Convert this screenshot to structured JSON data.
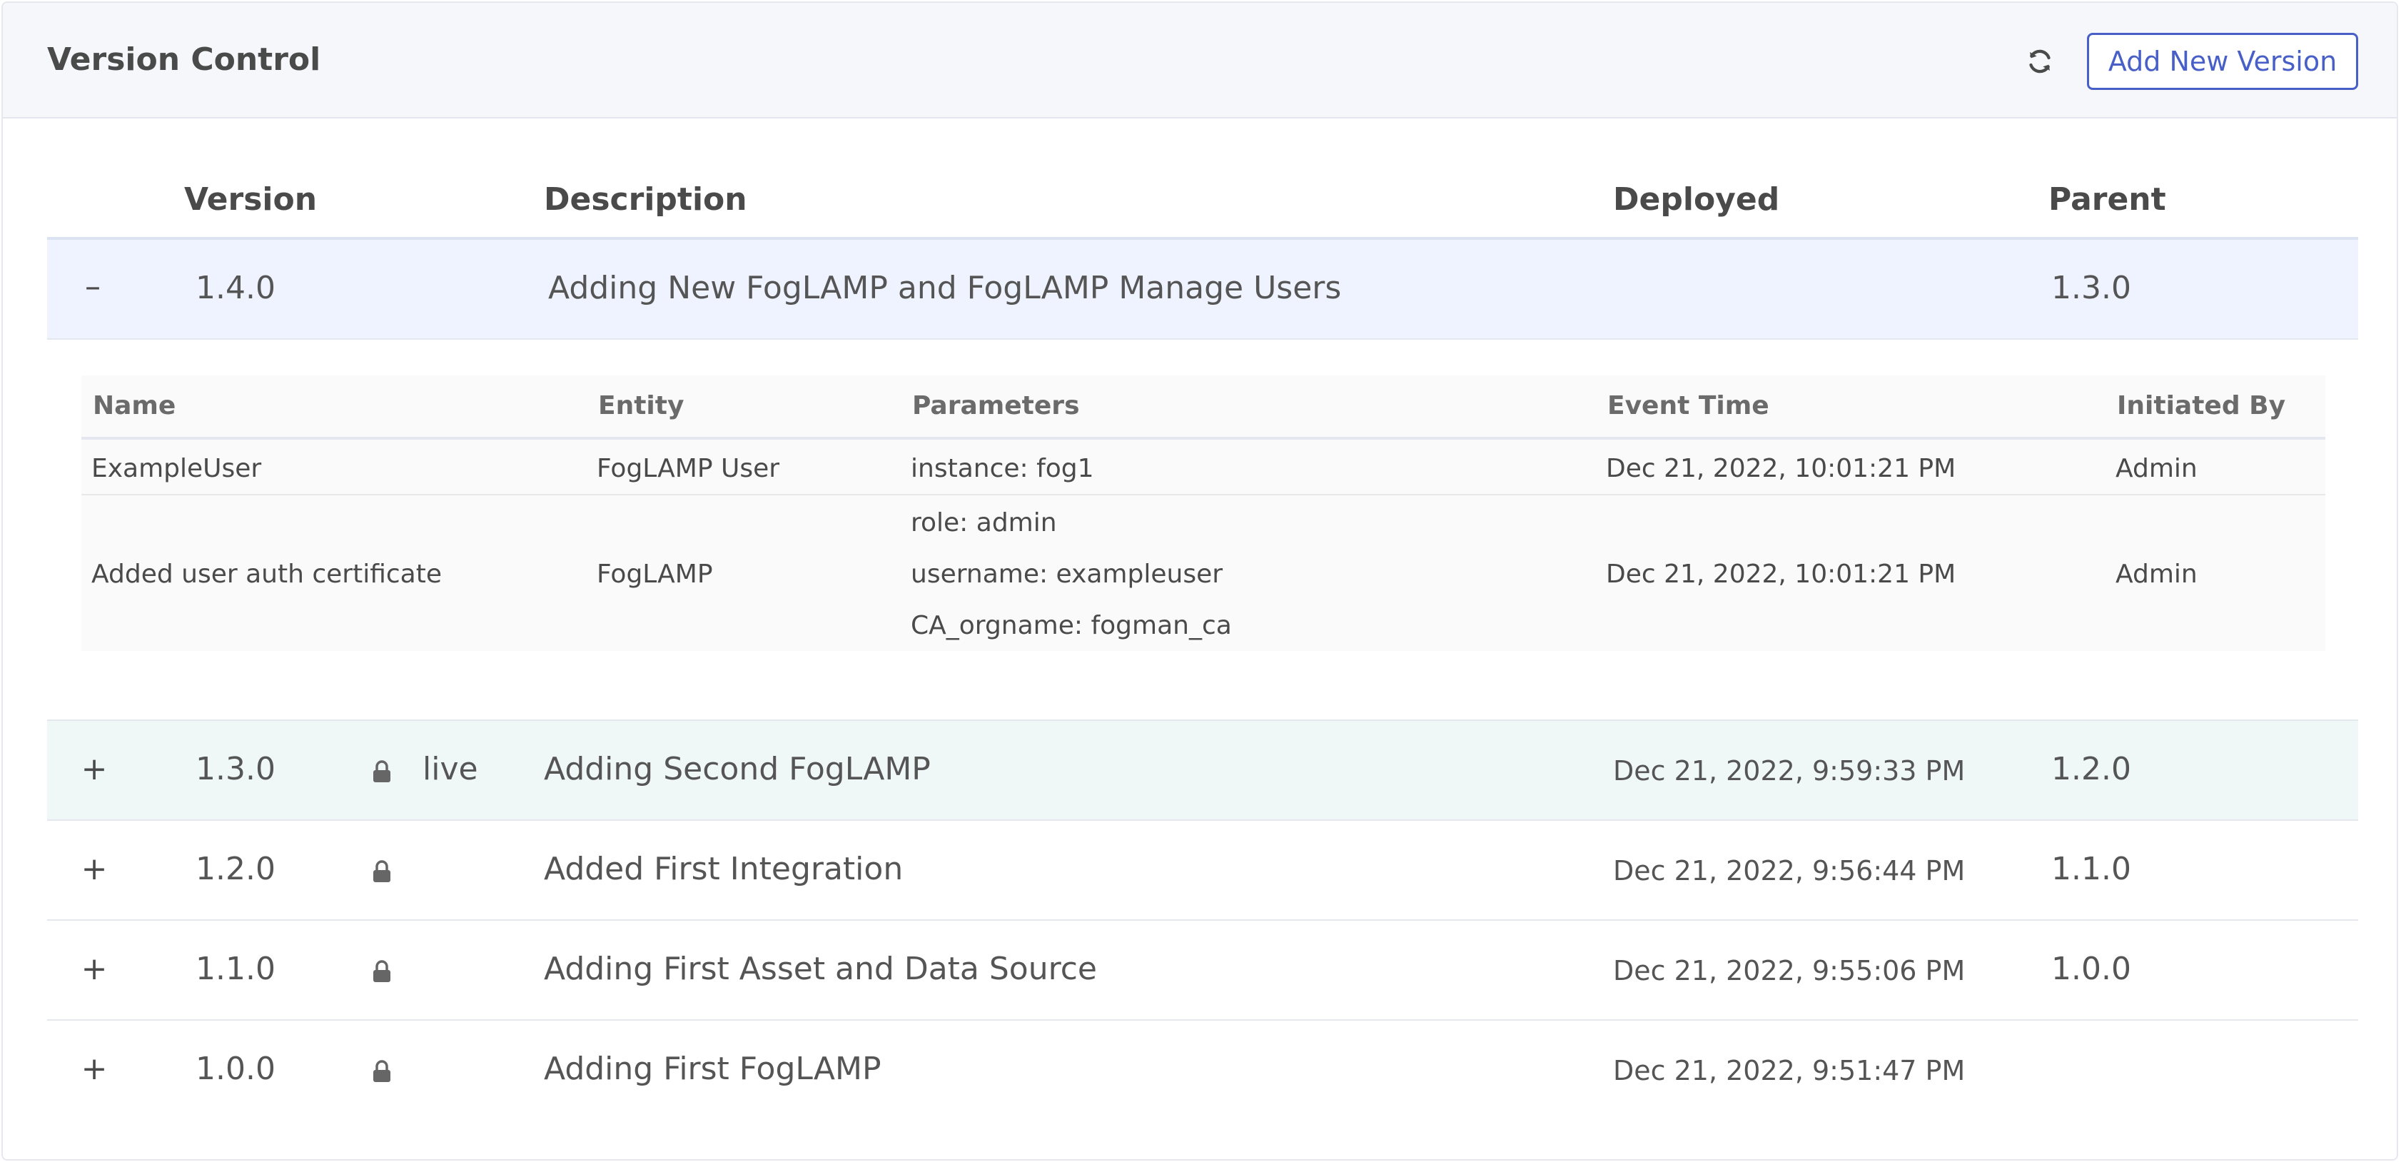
{
  "header": {
    "title": "Version Control",
    "refresh_icon": "refresh-icon",
    "add_button_label": "Add New Version"
  },
  "table": {
    "columns": {
      "version": "Version",
      "description": "Description",
      "deployed": "Deployed",
      "parent": "Parent"
    },
    "rows": [
      {
        "toggle": "–",
        "version": "1.4.0",
        "locked": false,
        "live": "",
        "description": "Adding New FogLAMP and FogLAMP Manage Users",
        "deployed": "",
        "parent": "1.3.0",
        "expanded": true
      },
      {
        "toggle": "+",
        "version": "1.3.0",
        "locked": true,
        "live": "live",
        "description": "Adding Second FogLAMP",
        "deployed": "Dec 21, 2022, 9:59:33 PM",
        "parent": "1.2.0"
      },
      {
        "toggle": "+",
        "version": "1.2.0",
        "locked": true,
        "live": "",
        "description": "Added First Integration",
        "deployed": "Dec 21, 2022, 9:56:44 PM",
        "parent": "1.1.0"
      },
      {
        "toggle": "+",
        "version": "1.1.0",
        "locked": true,
        "live": "",
        "description": "Adding First Asset and Data Source",
        "deployed": "Dec 21, 2022, 9:55:06 PM",
        "parent": "1.0.0"
      },
      {
        "toggle": "+",
        "version": "1.0.0",
        "locked": true,
        "live": "",
        "description": "Adding First FogLAMP",
        "deployed": "Dec 21, 2022, 9:51:47 PM",
        "parent": ""
      }
    ]
  },
  "changes": {
    "columns": {
      "name": "Name",
      "entity": "Entity",
      "parameters": "Parameters",
      "event_time": "Event Time",
      "initiated_by": "Initiated By"
    },
    "rows": [
      {
        "name": "ExampleUser",
        "entity": "FogLAMP User",
        "parameters": [
          "instance: fog1"
        ],
        "event_time": "Dec 21, 2022, 10:01:21 PM",
        "initiated_by": "Admin"
      },
      {
        "name": "Added user auth certificate",
        "entity": "FogLAMP",
        "parameters": [
          "role: admin",
          "username: exampleuser",
          "CA_orgname: fogman_ca"
        ],
        "event_time": "Dec 21, 2022, 10:01:21 PM",
        "initiated_by": "Admin"
      }
    ]
  },
  "icons": {
    "lock": "lock-icon"
  },
  "colors": {
    "accent": "#485fc7",
    "expanded_row_bg": "#eef3ff",
    "live_row_bg": "#eff8f6",
    "header_bg": "#f5f7fb"
  }
}
